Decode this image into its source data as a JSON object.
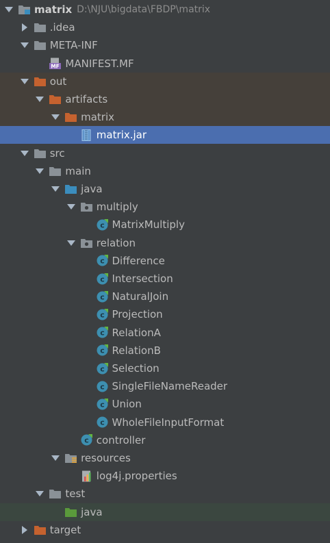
{
  "project": {
    "name": "matrix",
    "path": "D:\\NJU\\bigdata\\FBDP\\matrix"
  },
  "tree": [
    {
      "label": "matrix",
      "depth": 0,
      "arrow": "down",
      "icon": "module-folder-icon",
      "name": "project-root"
    },
    {
      "label": ".idea",
      "depth": 1,
      "arrow": "right",
      "icon": "folder-icon",
      "name": "folder-idea"
    },
    {
      "label": "META-INF",
      "depth": 1,
      "arrow": "down",
      "icon": "folder-icon",
      "name": "folder-meta-inf"
    },
    {
      "label": "MANIFEST.MF",
      "depth": 2,
      "arrow": "none",
      "icon": "manifest-file-icon",
      "name": "file-manifest"
    },
    {
      "label": "out",
      "depth": 1,
      "arrow": "down",
      "icon": "excluded-folder-icon",
      "name": "folder-out",
      "style": "excl"
    },
    {
      "label": "artifacts",
      "depth": 2,
      "arrow": "down",
      "icon": "excluded-folder-icon",
      "name": "folder-artifacts",
      "style": "excl"
    },
    {
      "label": "matrix",
      "depth": 3,
      "arrow": "down",
      "icon": "excluded-folder-icon",
      "name": "folder-artifacts-matrix",
      "style": "excl"
    },
    {
      "label": "matrix.jar",
      "depth": 4,
      "arrow": "none",
      "icon": "jar-file-icon",
      "name": "file-matrix-jar",
      "style": "selected"
    },
    {
      "label": "src",
      "depth": 1,
      "arrow": "down",
      "icon": "folder-icon",
      "name": "folder-src"
    },
    {
      "label": "main",
      "depth": 2,
      "arrow": "down",
      "icon": "folder-icon",
      "name": "folder-main"
    },
    {
      "label": "java",
      "depth": 3,
      "arrow": "down",
      "icon": "source-folder-icon",
      "name": "folder-main-java"
    },
    {
      "label": "multiply",
      "depth": 4,
      "arrow": "down",
      "icon": "package-icon",
      "name": "package-multiply"
    },
    {
      "label": "MatrixMultiply",
      "depth": 5,
      "arrow": "none",
      "icon": "java-class-icon",
      "name": "class-matrixmultiply"
    },
    {
      "label": "relation",
      "depth": 4,
      "arrow": "down",
      "icon": "package-icon",
      "name": "package-relation"
    },
    {
      "label": "Difference",
      "depth": 5,
      "arrow": "none",
      "icon": "java-class-icon",
      "name": "class-difference"
    },
    {
      "label": "Intersection",
      "depth": 5,
      "arrow": "none",
      "icon": "java-class-icon",
      "name": "class-intersection"
    },
    {
      "label": "NaturalJoin",
      "depth": 5,
      "arrow": "none",
      "icon": "java-class-icon",
      "name": "class-naturaljoin"
    },
    {
      "label": "Projection",
      "depth": 5,
      "arrow": "none",
      "icon": "java-class-icon",
      "name": "class-projection"
    },
    {
      "label": "RelationA",
      "depth": 5,
      "arrow": "none",
      "icon": "java-class-icon",
      "name": "class-relationa"
    },
    {
      "label": "RelationB",
      "depth": 5,
      "arrow": "none",
      "icon": "java-class-icon",
      "name": "class-relationb"
    },
    {
      "label": "Selection",
      "depth": 5,
      "arrow": "none",
      "icon": "java-class-icon",
      "name": "class-selection"
    },
    {
      "label": "SingleFileNameReader",
      "depth": 5,
      "arrow": "none",
      "icon": "java-class-plain-icon",
      "name": "class-singlefilenamereader"
    },
    {
      "label": "Union",
      "depth": 5,
      "arrow": "none",
      "icon": "java-class-icon",
      "name": "class-union"
    },
    {
      "label": "WholeFileInputFormat",
      "depth": 5,
      "arrow": "none",
      "icon": "java-class-plain-icon",
      "name": "class-wholefileinputformat"
    },
    {
      "label": "controller",
      "depth": 4,
      "arrow": "none",
      "icon": "java-class-icon",
      "name": "class-controller"
    },
    {
      "label": "resources",
      "depth": 3,
      "arrow": "down",
      "icon": "resources-folder-icon",
      "name": "folder-resources"
    },
    {
      "label": "log4j.properties",
      "depth": 4,
      "arrow": "none",
      "icon": "properties-file-icon",
      "name": "file-log4j-properties"
    },
    {
      "label": "test",
      "depth": 2,
      "arrow": "down",
      "icon": "folder-icon",
      "name": "folder-test"
    },
    {
      "label": "java",
      "depth": 3,
      "arrow": "none",
      "icon": "test-source-folder-icon",
      "name": "folder-test-java",
      "style": "test"
    },
    {
      "label": "target",
      "depth": 1,
      "arrow": "right",
      "icon": "excluded-folder-icon",
      "name": "folder-target"
    }
  ],
  "colors": {
    "background": "#3c3f41",
    "selection": "#4b6eaf",
    "excluded_row": "#45403a",
    "test_row": "#3b4740",
    "folder": "#8a9197",
    "excluded_folder": "#c5622f",
    "source_folder": "#3b8dbd",
    "test_folder": "#5a9a3b",
    "class_icon": "#3d8fb0",
    "class_badge": "#62b543"
  }
}
